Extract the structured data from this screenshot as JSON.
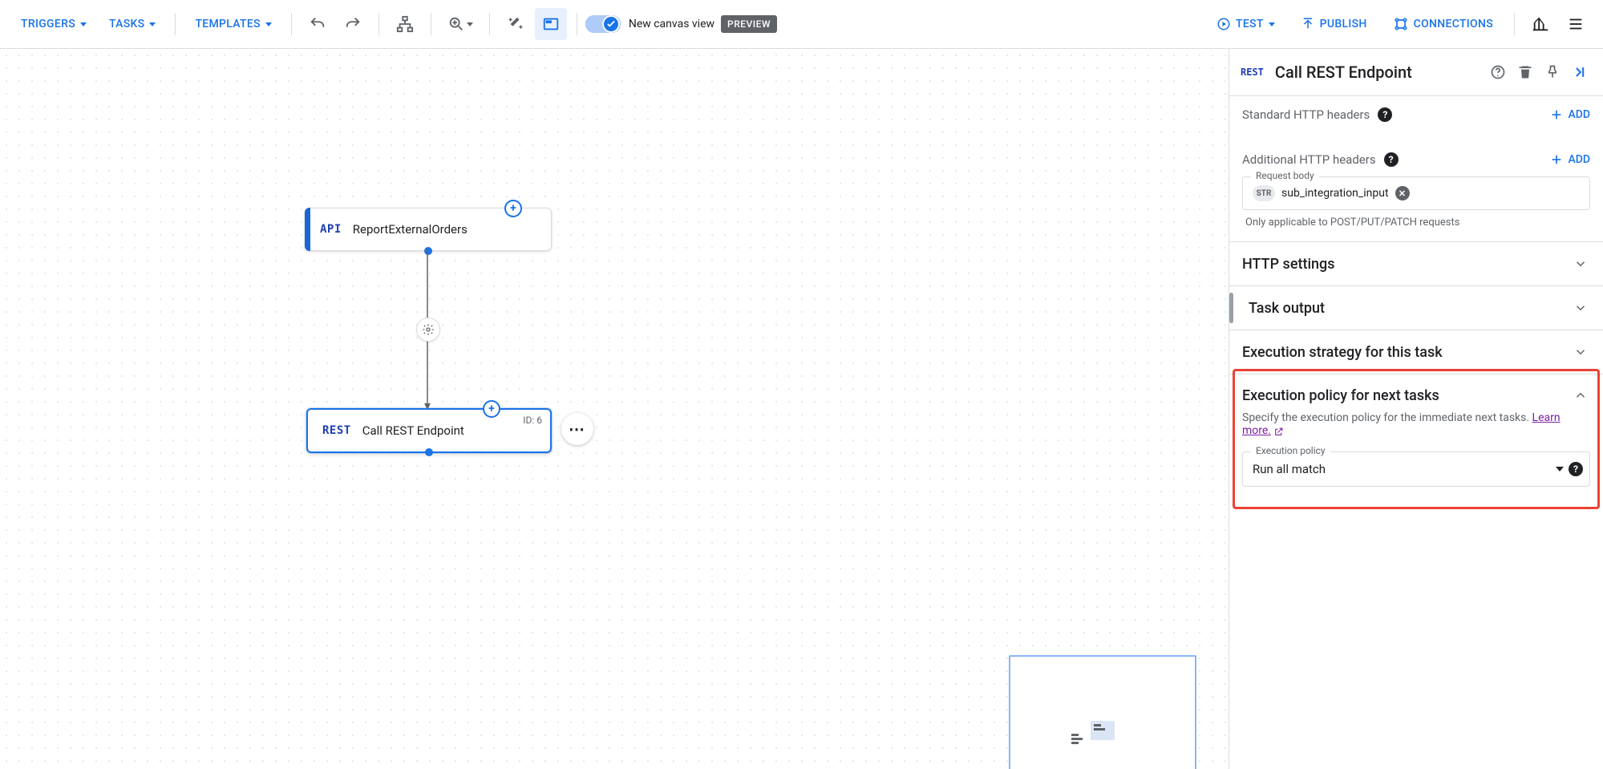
{
  "toolbar": {
    "triggers": "TRIGGERS",
    "tasks": "TASKS",
    "templates": "TEMPLATES",
    "canvas_label": "New canvas view",
    "preview_badge": "PREVIEW",
    "test": "TEST",
    "publish": "PUBLISH",
    "connections": "CONNECTIONS"
  },
  "canvas": {
    "trigger_node": {
      "tag": "API",
      "title": "ReportExternalOrders"
    },
    "task_node": {
      "tag": "REST",
      "title": "Call REST Endpoint",
      "id_label": "ID: 6"
    }
  },
  "panel": {
    "header": {
      "tag": "REST",
      "title": "Call REST Endpoint"
    },
    "std_headers_label": "Standard HTTP headers",
    "add_headers_label": "Additional HTTP headers",
    "add_button": "ADD",
    "request_body": {
      "legend": "Request body",
      "chip_type": "STR",
      "chip_value": "sub_integration_input",
      "hint": "Only applicable to POST/PUT/PATCH requests"
    },
    "sections": {
      "http": "HTTP settings",
      "task_output": "Task output",
      "exec_strategy": "Execution strategy for this task"
    },
    "exec_policy": {
      "title": "Execution policy for next tasks",
      "desc": "Specify the execution policy for the immediate next tasks.",
      "learn_more": "Learn more.",
      "legend": "Execution policy",
      "value": "Run all match"
    }
  }
}
